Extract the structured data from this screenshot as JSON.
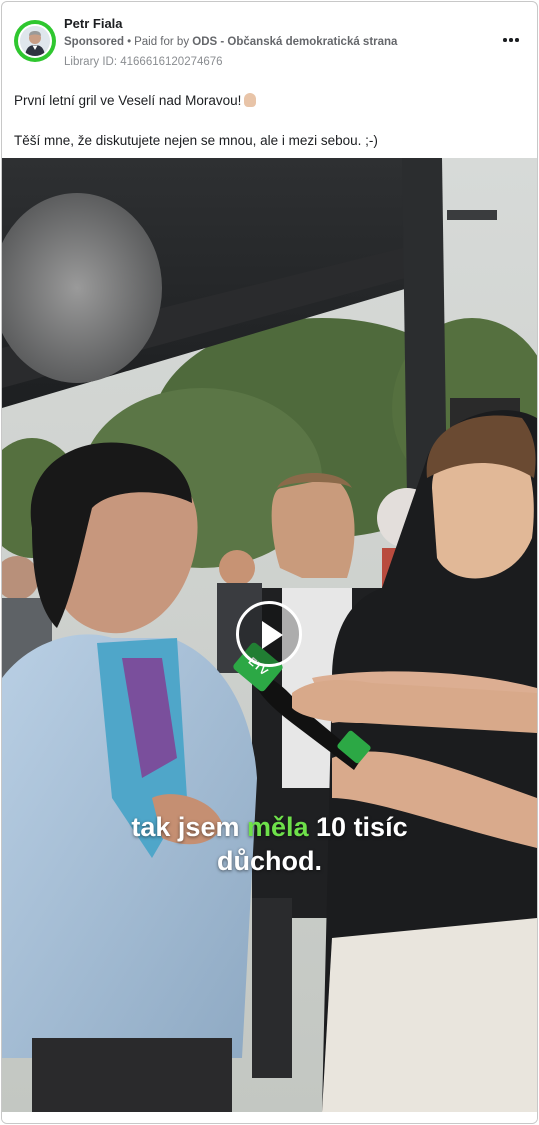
{
  "post": {
    "author": "Petr Fiala",
    "sponsored_label": "Sponsored",
    "separator": "•",
    "paid_for_prefix": "Paid for by",
    "payer": "ODS - Občanská demokratická strana",
    "library_id": "Library ID: 4166616120274676",
    "text_line1": "První letní gril ve Veselí nad Moravou!",
    "text_line2": "Těší mne, že diskutujete nejen se mnou, ale i mezi sebou. ;-)"
  },
  "video": {
    "caption_before": "tak jsem ",
    "caption_highlight": "měla",
    "caption_after": " 10 tisíc",
    "caption_line2": "důchod.",
    "caption_highlight_color": "#6ee04a",
    "mic_label": "ETV"
  },
  "icons": {
    "more": "more-horizontal-icon",
    "play": "play-icon"
  },
  "colors": {
    "avatar_ring": "#2fc72f",
    "text": "#1c1e21",
    "muted": "#65676b"
  }
}
